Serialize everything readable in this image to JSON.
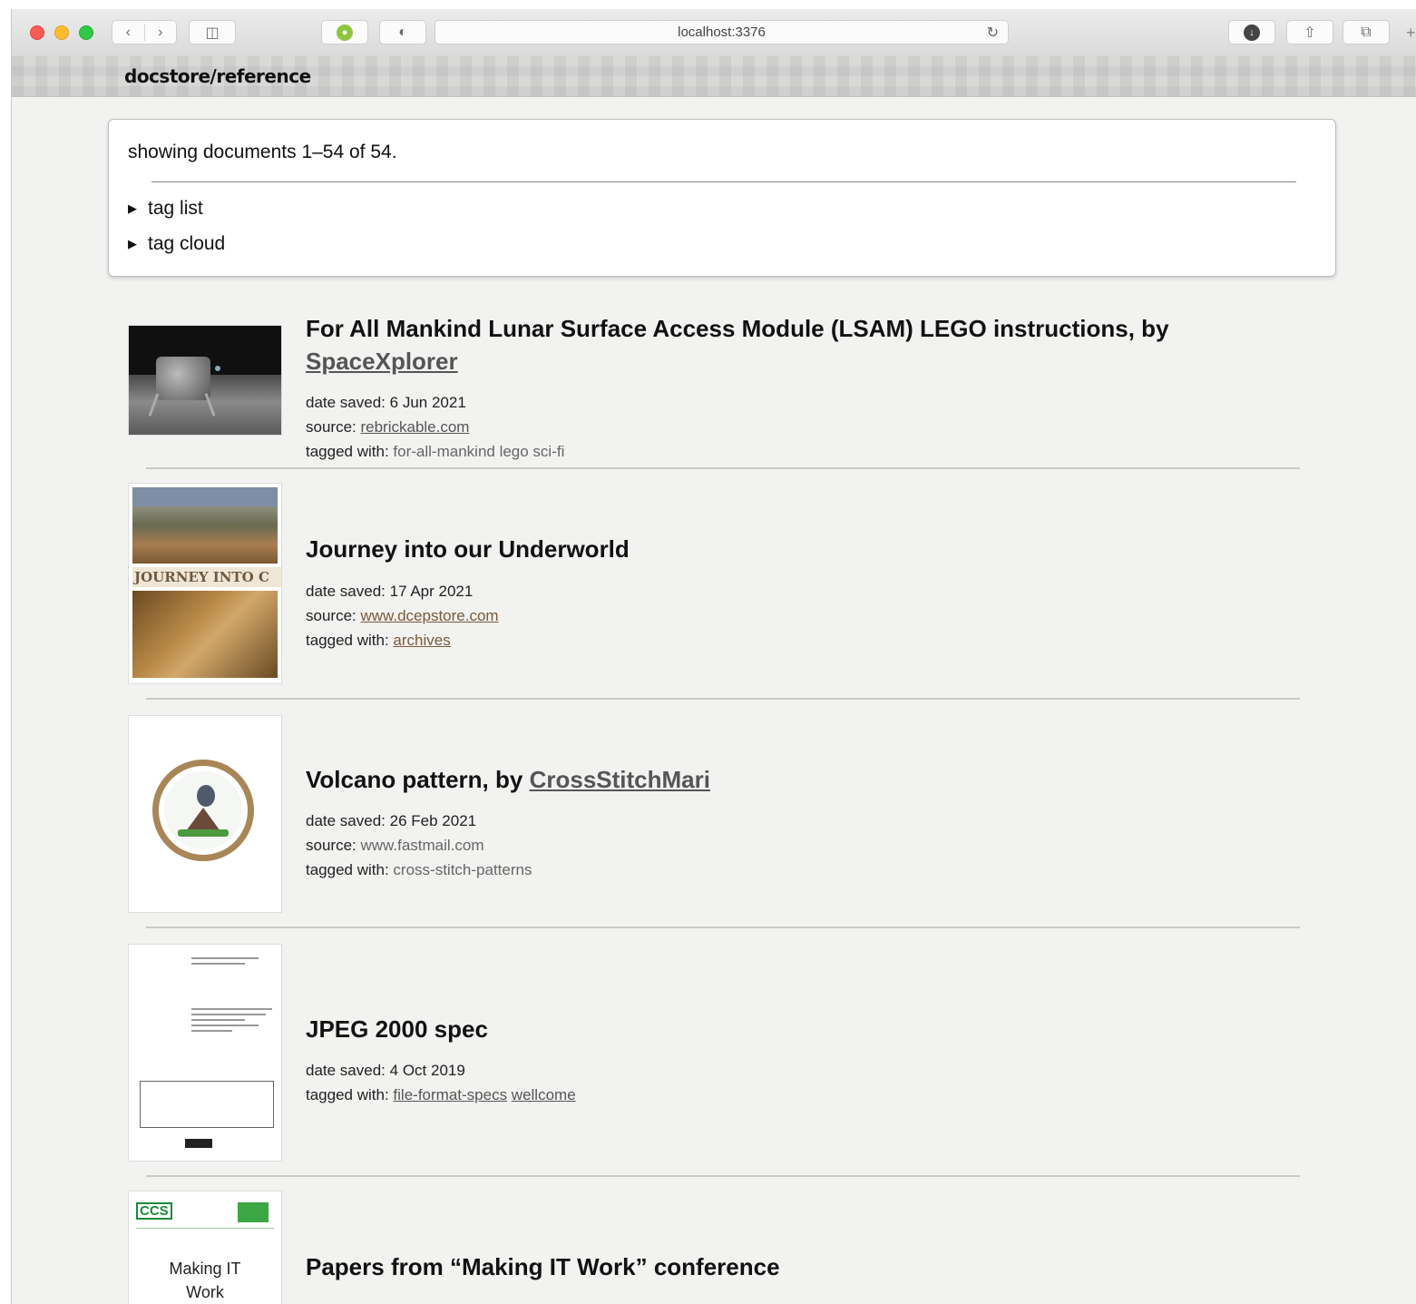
{
  "browser": {
    "url": "localhost:3376",
    "icons": {
      "back": "chevron-left-icon",
      "forward": "chevron-right-icon",
      "sidebar": "sidebar-icon",
      "extension": "extension-icon",
      "reader": "reader-icon",
      "reload": "reload-icon",
      "download": "download-icon",
      "share": "share-icon",
      "tabs": "tabs-icon",
      "new_tab": "plus-icon"
    }
  },
  "site": {
    "title": "docstore/reference"
  },
  "summary": {
    "text": "showing documents 1–54 of 54.",
    "disclosures": [
      "tag list",
      "tag cloud"
    ]
  },
  "documents": [
    {
      "title": "For All Mankind Lunar Surface Access Module (LSAM) LEGO instructions, by",
      "author": "SpaceXplorer",
      "date_label": "date saved:",
      "date": "6 Jun 2021",
      "source_label": "source:",
      "source": "rebrickable.com",
      "tags_label": "tagged with:",
      "tags": "for-all-mankind lego sci-fi"
    },
    {
      "title": "Journey into our Underworld",
      "date_label": "date saved:",
      "date": "17 Apr 2021",
      "source_label": "source:",
      "source": "www.dcepstore.com",
      "tags_label": "tagged with:",
      "tags": "archives",
      "thumb_text": "JOURNEY INTO C"
    },
    {
      "title_prefix": "Volcano pattern, by",
      "author": "CrossStitchMari",
      "date_label": "date saved:",
      "date": "26 Feb 2021",
      "source_label": "source:",
      "source": "www.fastmail.com",
      "tags_label": "tagged with:",
      "tags": "cross-stitch-patterns"
    },
    {
      "title": "JPEG 2000 spec",
      "date_label": "date saved:",
      "date": "4 Oct 2019",
      "tags_label": "tagged with:",
      "tags": [
        "file-format-specs",
        "wellcome"
      ]
    },
    {
      "title": "Papers from “Making IT Work” conference",
      "thumb_logo": "CCS",
      "thumb_text_1": "Making IT",
      "thumb_text_2": "Work"
    }
  ],
  "colors": {
    "page_bg": "#f2f2f1",
    "link": "#555555",
    "tag_link": "#7a5a3a"
  }
}
